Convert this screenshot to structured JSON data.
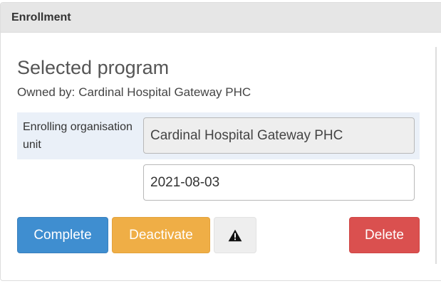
{
  "panel": {
    "title": "Enrollment"
  },
  "program": {
    "title": "Selected program",
    "owned_by_prefix": "Owned by:",
    "owned_by_value": "Cardinal Hospital Gateway PHC"
  },
  "enrollment_form": {
    "org_unit_label": "Enrolling organisation unit",
    "org_unit_value": "Cardinal Hospital Gateway PHC",
    "date_value": "2021-08-03"
  },
  "actions": {
    "complete_label": "Complete",
    "deactivate_label": "Deactivate",
    "warning_icon": "warning-triangle-icon",
    "delete_label": "Delete"
  },
  "colors": {
    "complete": "#3f8ed0",
    "deactivate": "#efae46",
    "delete": "#da504f",
    "header_bg": "#e6e6e6",
    "org_row_bg": "#eaf0f8"
  }
}
